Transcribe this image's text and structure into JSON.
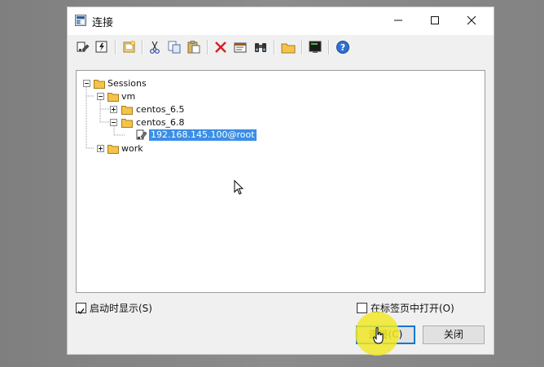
{
  "window": {
    "title": "连接",
    "accent": "#3a8ee6"
  },
  "toolbar": {
    "icons": [
      "connect-icon",
      "quick-connect-icon",
      "new-session-icon",
      "cut-icon",
      "copy-icon",
      "paste-icon",
      "delete-icon",
      "properties-icon",
      "find-icon",
      "new-folder-icon",
      "terminal-icon",
      "help-icon"
    ]
  },
  "tree": {
    "root": "Sessions",
    "vm": "vm",
    "centos65": "centos_6.5",
    "centos68": "centos_6.8",
    "session": "192.168.145.100@root",
    "work": "work"
  },
  "footer": {
    "show_on_startup": "启动时显示(S)",
    "show_on_startup_checked": true,
    "open_in_tab": "在标签页中打开(O)",
    "open_in_tab_checked": false,
    "connect_button": "连接(C)",
    "close_button": "关闭"
  }
}
